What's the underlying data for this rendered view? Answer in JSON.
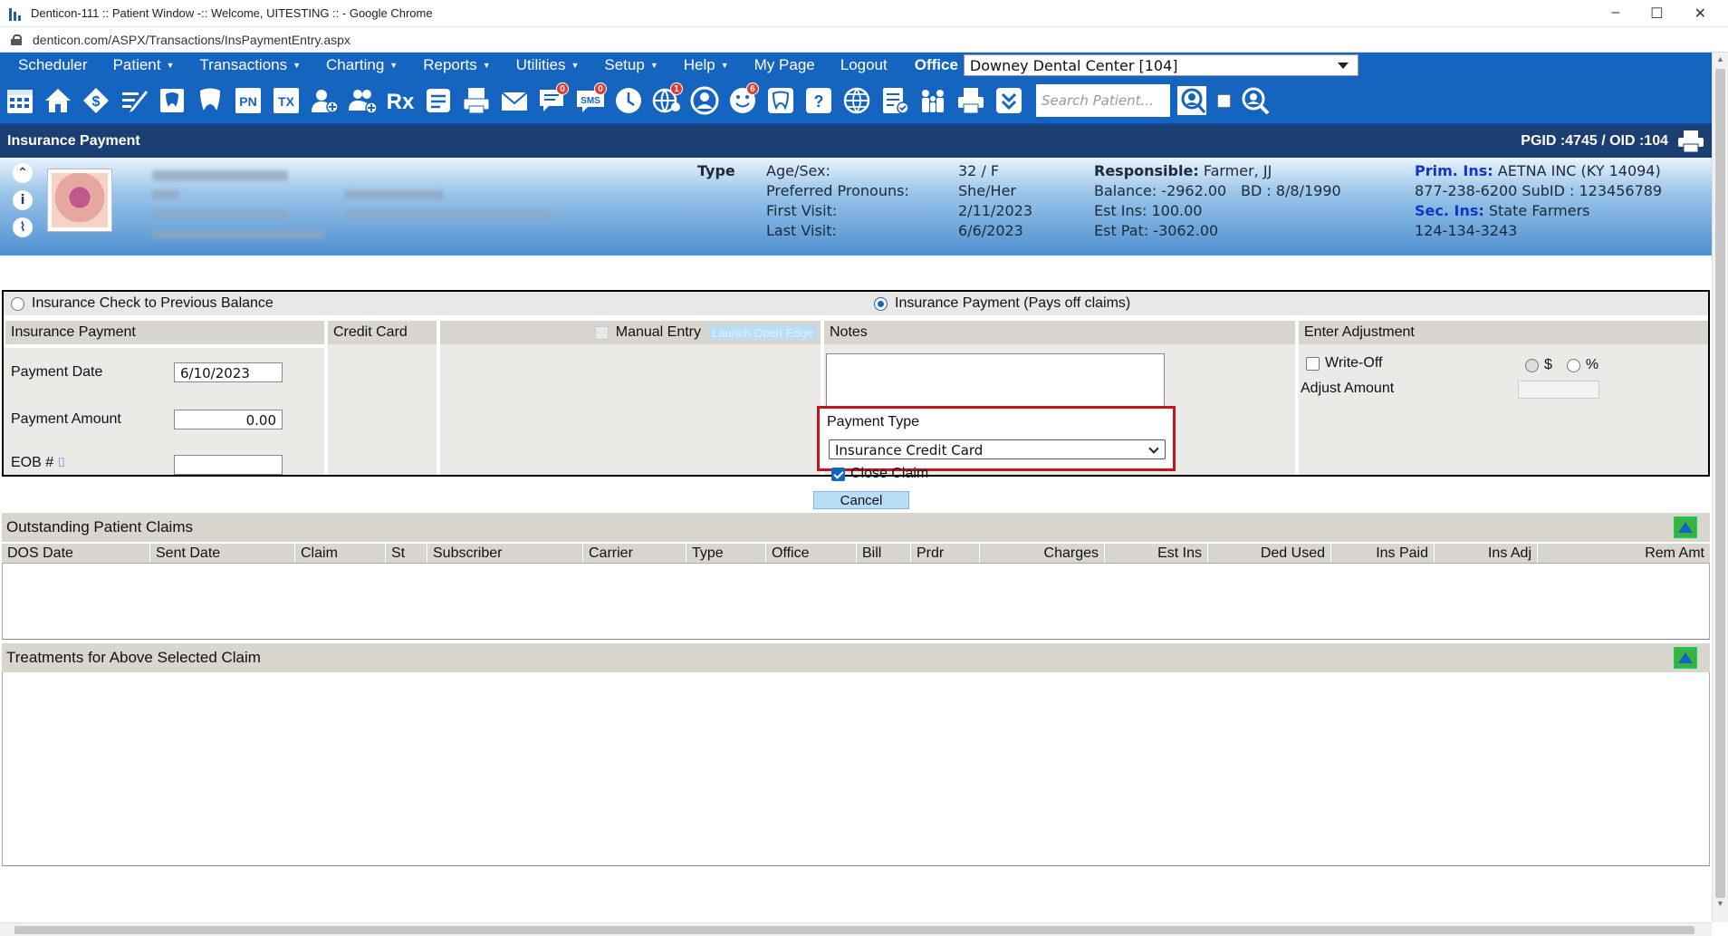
{
  "browser": {
    "window_title": "Denticon-111 :: Patient Window -:: Welcome, UITESTING :: - Google Chrome",
    "url": "denticon.com/ASPX/Transactions/InsPaymentEntry.aspx",
    "controls": {
      "minimize": "–",
      "maximize": "☐",
      "close": "✕"
    }
  },
  "menu": {
    "items": [
      {
        "label": "Scheduler",
        "caret": ""
      },
      {
        "label": "Patient",
        "caret": "▼"
      },
      {
        "label": "Transactions",
        "caret": "▼"
      },
      {
        "label": "Charting",
        "caret": "▼"
      },
      {
        "label": "Reports",
        "caret": "▼"
      },
      {
        "label": "Utilities",
        "caret": "▼"
      },
      {
        "label": "Setup",
        "caret": "▼"
      },
      {
        "label": "Help",
        "caret": "▼"
      },
      {
        "label": "My Page",
        "caret": ""
      },
      {
        "label": "Logout",
        "caret": ""
      }
    ],
    "office_label": "Office",
    "office_value": "Downey Dental Center [104]"
  },
  "toolbar": {
    "icons": [
      "calendar-icon",
      "home-icon",
      "dollar-arrows-icon",
      "pen-edit-icon",
      "tooth-chart-icon",
      "tooth-icon",
      "pn-icon",
      "tx-icon",
      "add-patient-icon",
      "add-family-icon",
      "rx-icon",
      "notes-icon",
      "print-doc-icon",
      "mail-icon",
      "message-icon",
      "sms-icon",
      "clock-icon",
      "globe-user-icon",
      "support-icon",
      "smile-icon",
      "tooth-outline-icon",
      "tooth-question-icon",
      "world-icon",
      "checklist-icon",
      "family-icon",
      "printer-icon",
      "download-icon"
    ],
    "badges": {
      "message": "0",
      "sms": "0",
      "globe-user": "1",
      "smile": "6"
    },
    "pn_text": "PN",
    "tx_text": "TX",
    "rx_text": "Rx",
    "sms_text": "SMS",
    "search_placeholder": "Search Patient..."
  },
  "page": {
    "title": "Insurance Payment",
    "ids": "PGID :4745  /  OID :104"
  },
  "patient": {
    "type_label": "Type",
    "age_sex_label": "Age/Sex:",
    "age_sex": "32 / F",
    "pronouns_label": "Preferred Pronouns:",
    "pronouns": "She/Her",
    "first_visit_label": "First Visit:",
    "first_visit": "2/11/2023",
    "last_visit_label": "Last Visit:",
    "last_visit": "6/6/2023",
    "responsible_label": "Responsible:",
    "responsible": "Farmer, JJ",
    "balance": "Balance: -2962.00",
    "bd": "BD : 8/8/1990",
    "est_ins": "Est Ins:  100.00",
    "est_pat": "Est Pat: -3062.00",
    "prim_ins_label": "Prim. Ins:",
    "prim_ins": "AETNA INC (KY 14094)",
    "prim_phone": "877-238-6200 SubID : 123456789",
    "sec_ins_label": "Sec. Ins:",
    "sec_ins": "State Farmers",
    "sec_phone": "124-134-3243"
  },
  "payment": {
    "opt_previous": "Insurance Check to Previous Balance",
    "opt_claims": "Insurance Payment (Pays off claims)",
    "hdr_ins_payment": "Insurance Payment",
    "hdr_credit_card": "Credit Card",
    "manual_entry": "Manual Entry",
    "launch_btn": "Launch Open Edge",
    "hdr_notes": "Notes",
    "hdr_adjust": "Enter Adjustment",
    "payment_date_label": "Payment Date",
    "payment_date": "6/10/2023",
    "payment_amount_label": "Payment Amount",
    "payment_amount": "0.00",
    "eob_label": "EOB #",
    "eob_value": "",
    "write_off": "Write-Off",
    "dollar": "$",
    "percent": "%",
    "adjust_amount_label": "Adjust Amount",
    "payment_type_label": "Payment Type",
    "payment_type": "Insurance Credit Card",
    "close_claim": "Close Claim",
    "cancel": "Cancel"
  },
  "claims": {
    "title": "Outstanding Patient Claims",
    "columns": [
      "DOS Date",
      "Sent Date",
      "Claim",
      "St",
      "Subscriber",
      "Carrier",
      "Type",
      "Office",
      "Bill",
      "Prdr",
      "Charges",
      "Est Ins",
      "Ded Used",
      "Ins Paid",
      "Ins Adj",
      "Rem Amt"
    ]
  },
  "treatments": {
    "title": "Treatments for Above Selected Claim"
  }
}
